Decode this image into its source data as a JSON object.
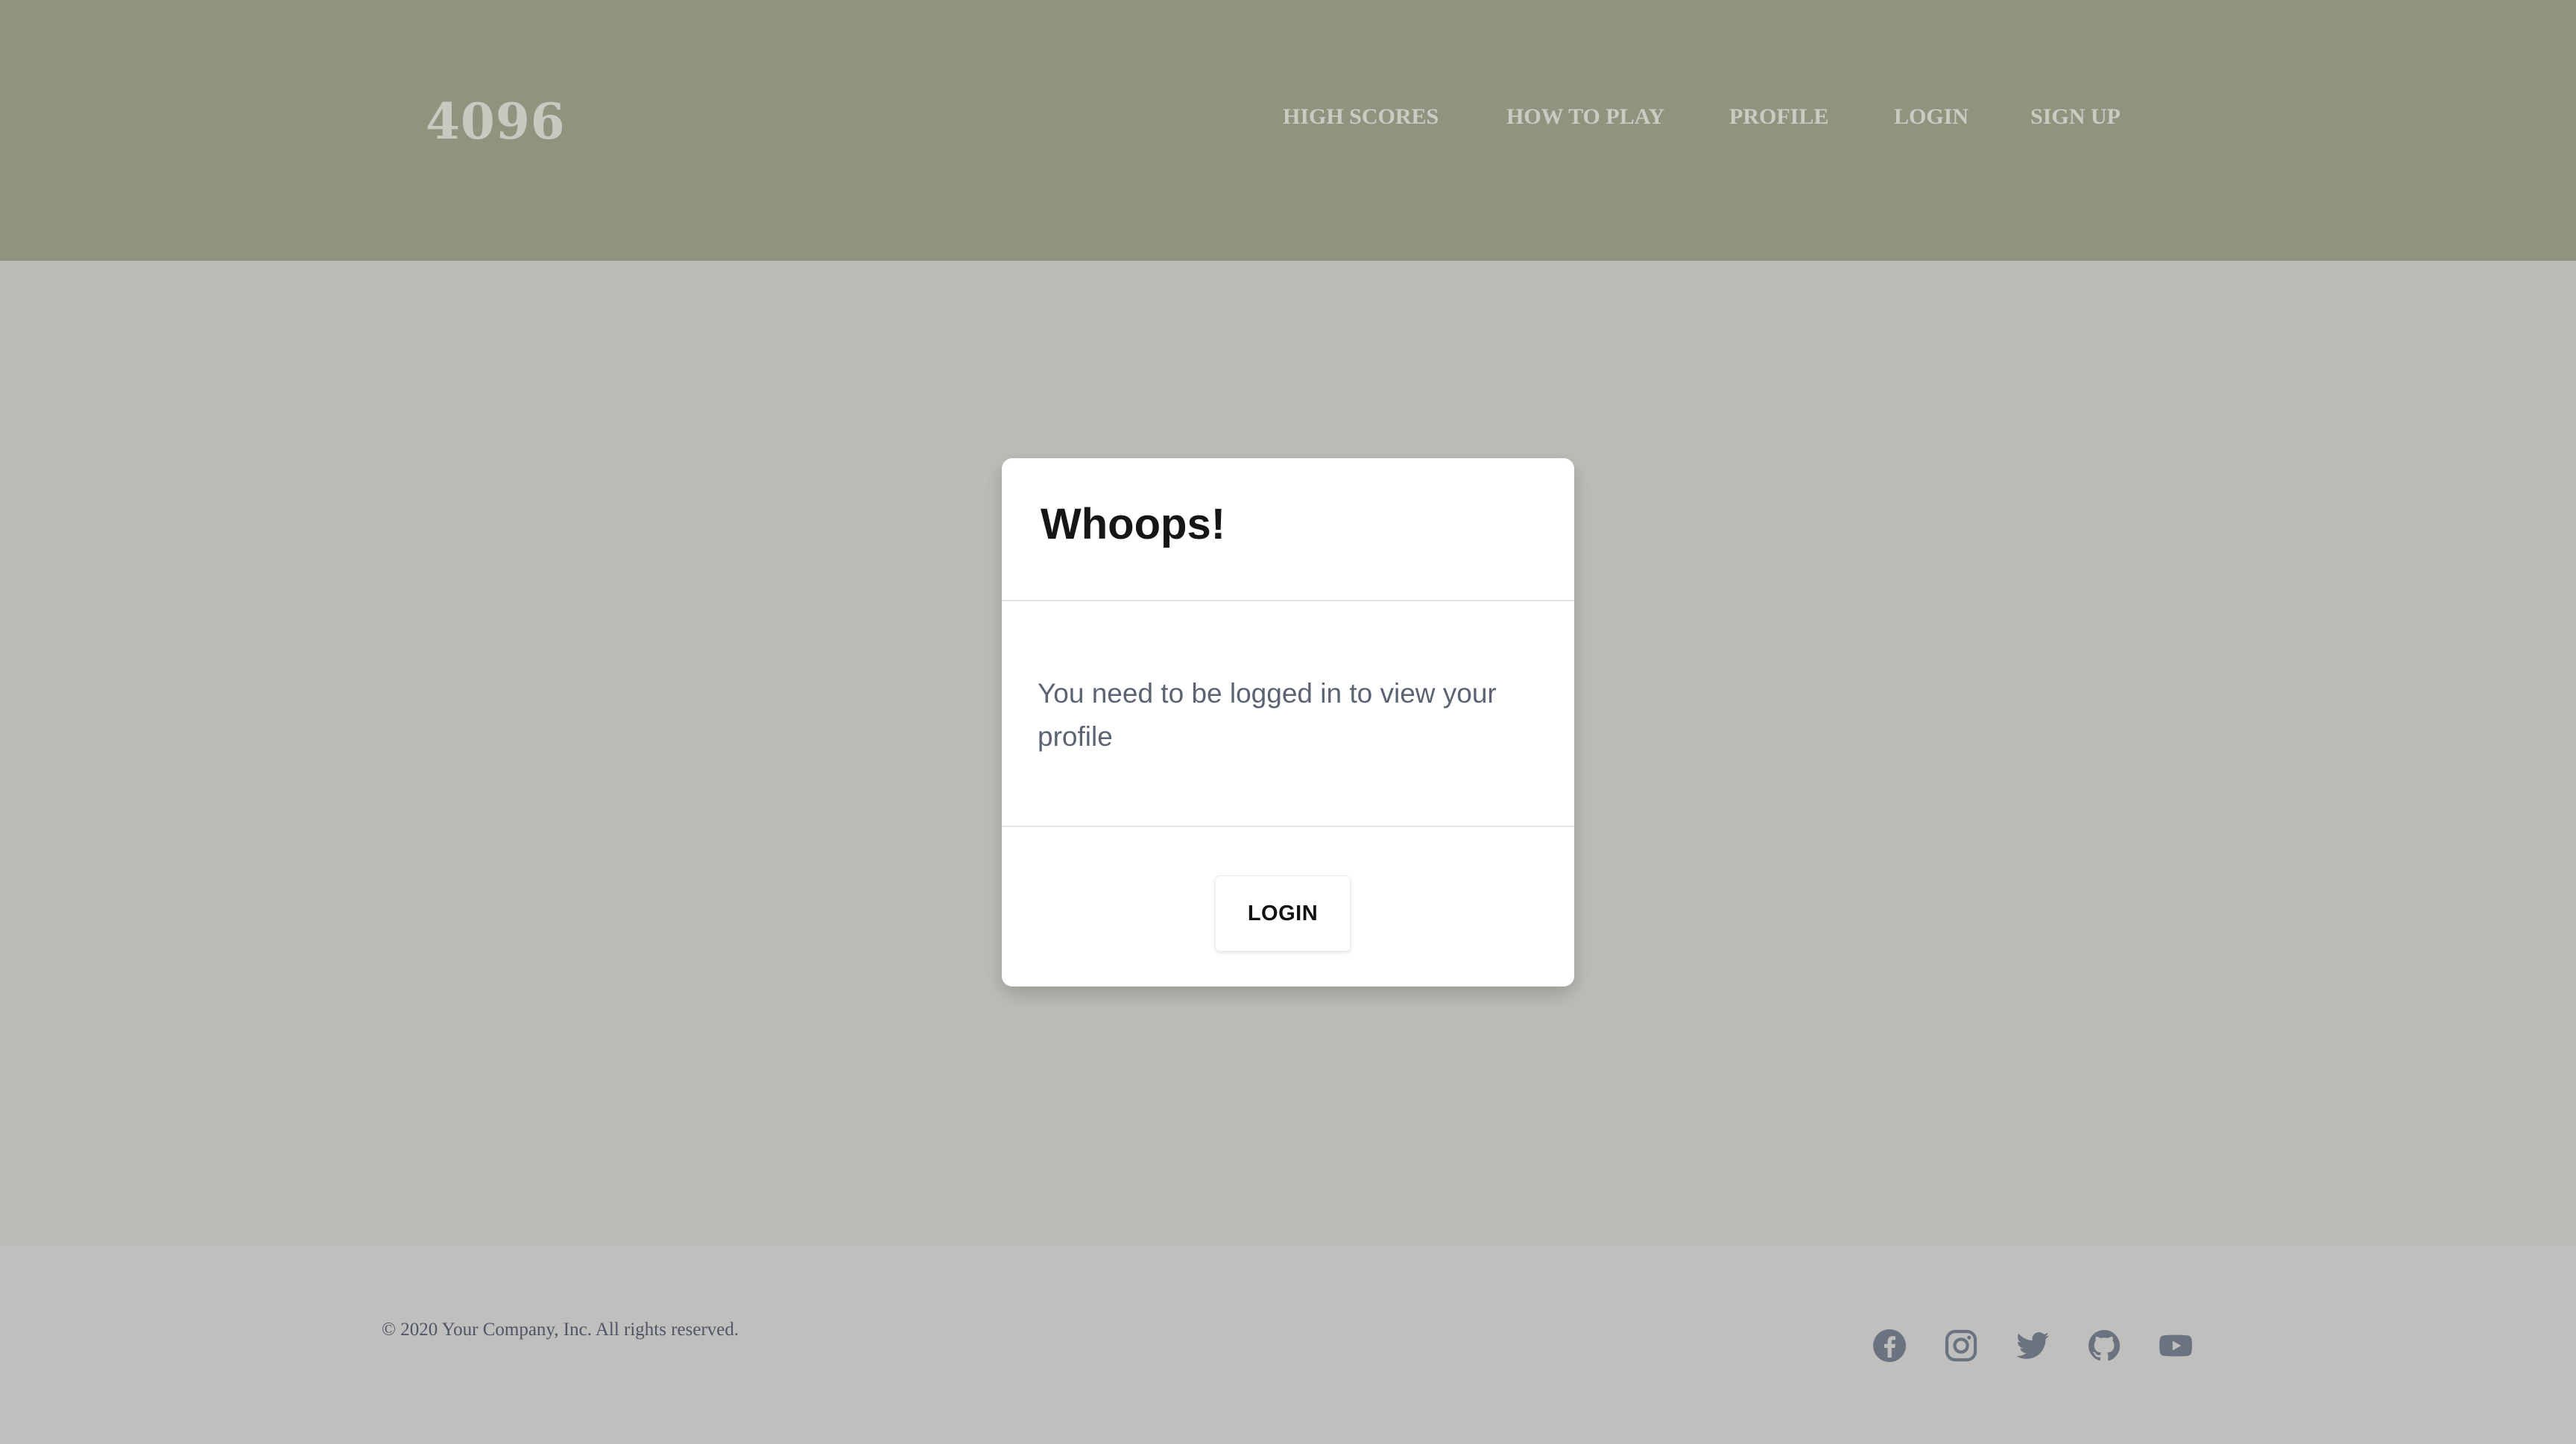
{
  "header": {
    "logo": "4096",
    "nav": [
      {
        "label": "HIGH SCORES"
      },
      {
        "label": "HOW TO PLAY"
      },
      {
        "label": "PROFILE"
      },
      {
        "label": "LOGIN"
      },
      {
        "label": "SIGN UP"
      }
    ]
  },
  "modal": {
    "title": "Whoops!",
    "message": "You need to be logged in to view your profile",
    "button_label": "LOGIN"
  },
  "footer": {
    "copyright": "© 2020 Your Company, Inc. All rights reserved.",
    "social": [
      {
        "icon": "facebook-icon"
      },
      {
        "icon": "instagram-icon"
      },
      {
        "icon": "twitter-icon"
      },
      {
        "icon": "github-icon"
      },
      {
        "icon": "youtube-icon"
      }
    ]
  },
  "colors": {
    "header_bg": "#92937f",
    "page_bg": "#bdbcb6",
    "footer_bg": "#bfbfbe",
    "nav_text": "#cbcbc4",
    "modal_bg": "#ffffff",
    "message_text": "#5c6474",
    "icon_color": "#6b7280"
  }
}
